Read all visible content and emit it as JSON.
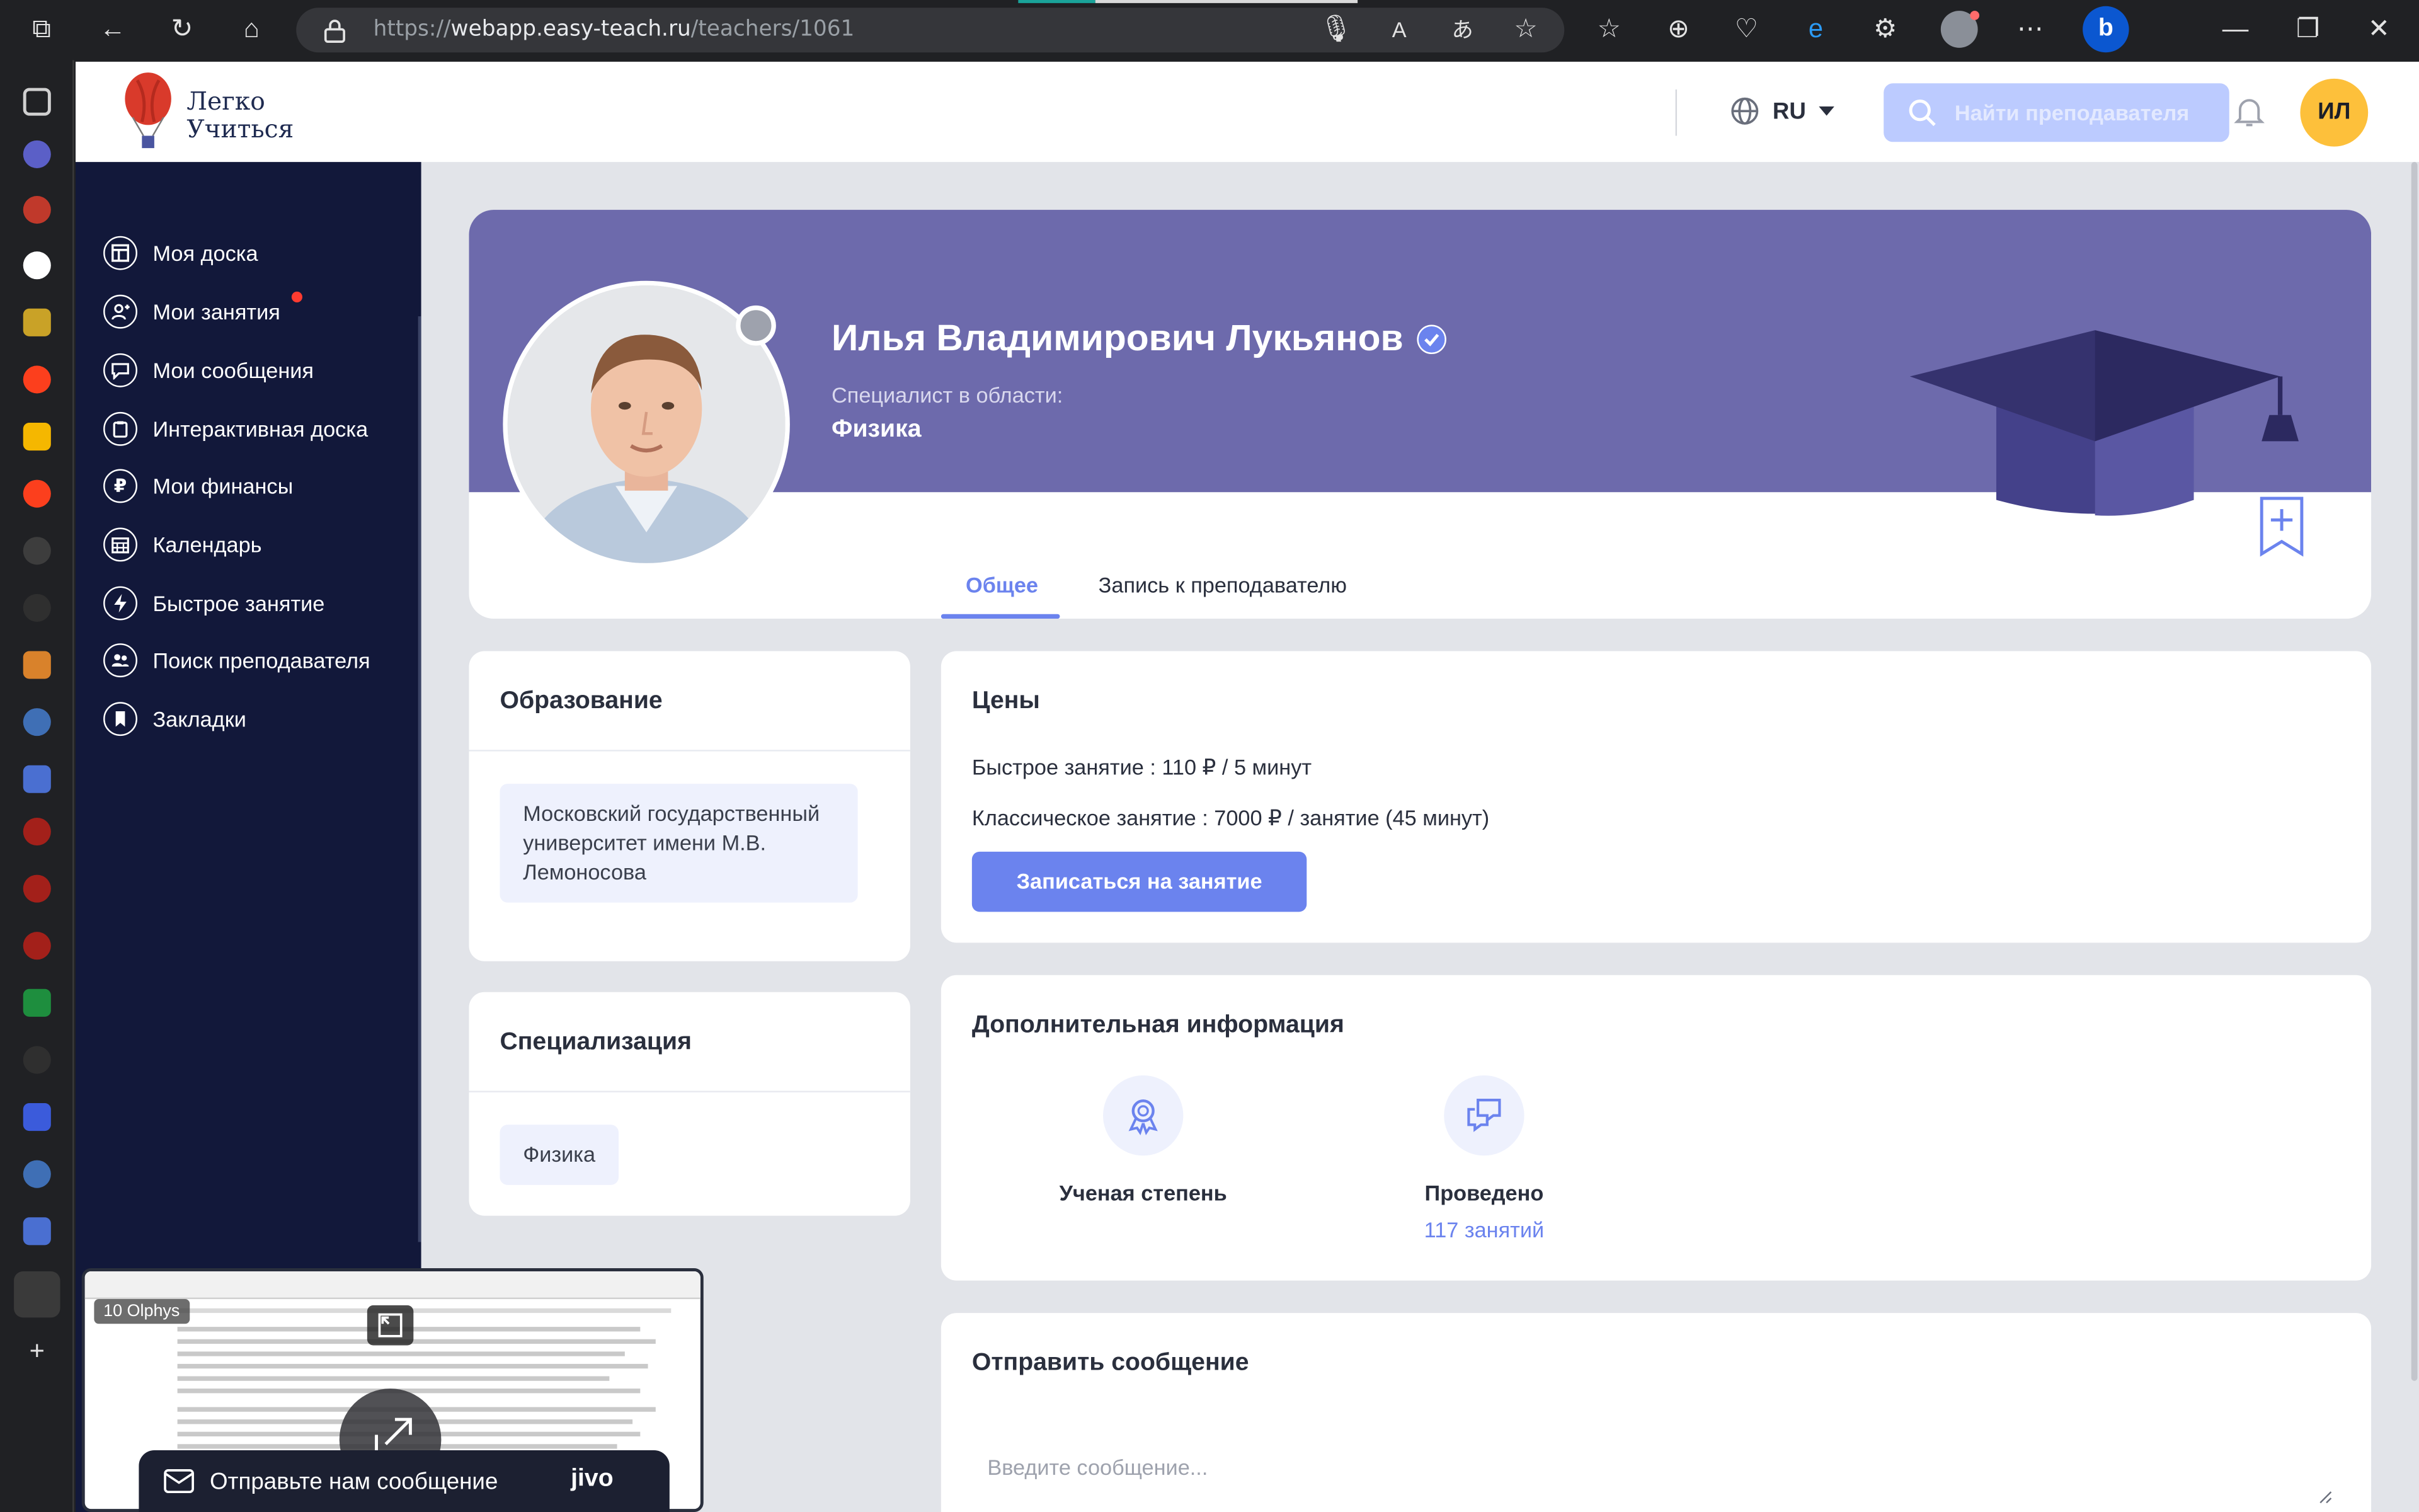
{
  "browser": {
    "url_prefix": "https://",
    "url_host": "webapp.easy-teach.ru",
    "url_path": "/teachers/1061"
  },
  "logo": {
    "line1": "Легко",
    "line2": "Учиться"
  },
  "topbar": {
    "language": "RU",
    "search_placeholder": "Найти преподавателя",
    "user_initials": "ИЛ"
  },
  "sidebar": {
    "items": [
      {
        "label": "Моя доска",
        "icon": "dashboard-icon"
      },
      {
        "label": "Мои занятия",
        "icon": "lessons-icon"
      },
      {
        "label": "Мои сообщения",
        "icon": "messages-icon"
      },
      {
        "label": "Интерактивная доска",
        "icon": "whiteboard-icon"
      },
      {
        "label": "Мои финансы",
        "icon": "ruble-icon"
      },
      {
        "label": "Календарь",
        "icon": "calendar-icon"
      },
      {
        "label": "Быстрое занятие",
        "icon": "lightning-icon"
      },
      {
        "label": "Поиск преподавателя",
        "icon": "teacher-search-icon"
      },
      {
        "label": "Закладки",
        "icon": "bookmark-icon"
      }
    ]
  },
  "profile": {
    "name": "Илья Владимирович Лукьянов",
    "specialist_label": "Специалист в области:",
    "specialty": "Физика",
    "tabs": [
      "Общее",
      "Запись к преподавателю"
    ]
  },
  "education": {
    "title": "Образование",
    "item": "Московский государственный университет имени М.В. Лемоносова"
  },
  "specialization": {
    "title": "Специализация",
    "item": "Физика"
  },
  "prices": {
    "title": "Цены",
    "quick": "Быстрое занятие : 110 ₽ / 5 минут",
    "classic": "Классическое занятие : 7000 ₽ / занятие (45 минут)",
    "button": "Записаться на занятие"
  },
  "additional": {
    "title": "Дополнительная информация",
    "degree_label": "Ученая степень",
    "conducted_label": "Проведено",
    "conducted_value": "117 занятий"
  },
  "message": {
    "title": "Отправить сообщение",
    "placeholder": "Введите сообщение..."
  },
  "preview": {
    "badge": "10 Olphys"
  },
  "jivo": {
    "label": "Отправьте нам сообщение",
    "brand": "jivo"
  },
  "colors": {
    "accent": "#6b83ee",
    "hero": "#6d6aac",
    "sidebar": "#12183a",
    "avatar": "#fdc03b"
  }
}
